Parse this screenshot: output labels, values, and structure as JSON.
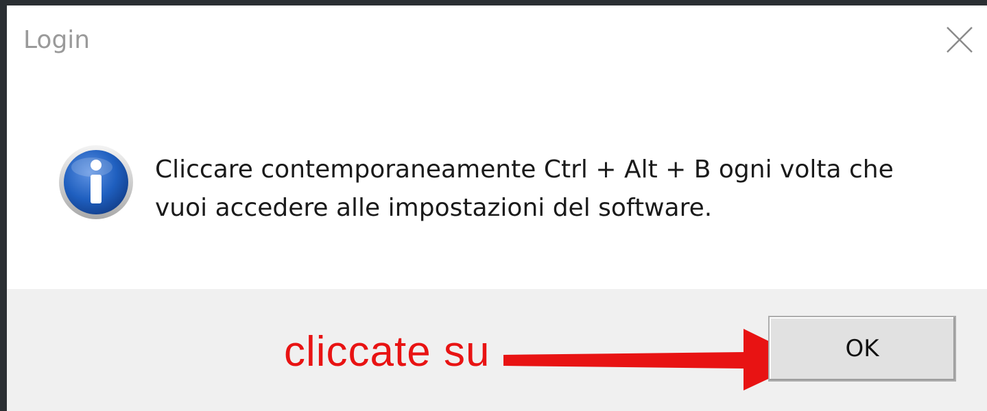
{
  "dialog": {
    "title": "Login",
    "close_icon": "close-icon",
    "info_icon": "info-icon",
    "message": "Cliccare contemporaneamente Ctrl + Alt + B ogni volta che vuoi accedere alle impostazioni del software.",
    "ok_label": "OK"
  },
  "annotation": {
    "text": "cliccate su",
    "arrow_icon": "arrow-right-icon",
    "color": "#e81313"
  },
  "colors": {
    "dialog_bg": "#ffffff",
    "footer_bg": "#f0f0f0",
    "title_text": "#9a9a9a",
    "info_blue": "#1f5fbf"
  }
}
